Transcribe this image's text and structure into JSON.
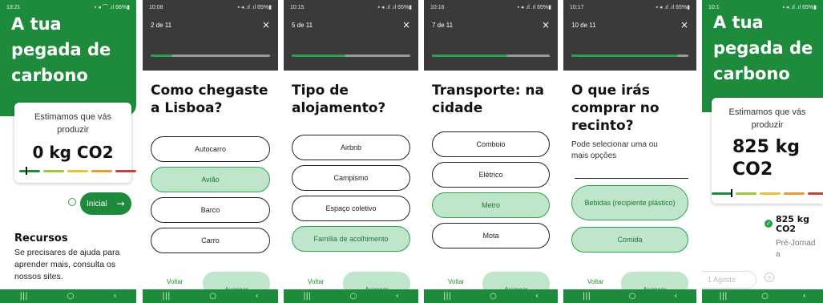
{
  "screens": [
    {
      "status_time": "13:21",
      "status_icons": "▪ ◂ ⌒ .ıl 66%▮",
      "title_lines": [
        "A tua",
        "pegada de",
        "carbono"
      ],
      "estimate_lines": [
        "Estimamos que vás",
        "produzir"
      ],
      "value": "0 kg CO2",
      "button_label": "Inicial",
      "resources_title": "Recursos",
      "resources_text": [
        "Se precisares de ajuda para",
        "aprender mais, consulta os",
        "nossos sites."
      ]
    },
    {
      "status_time": "10:08",
      "status_icons": "▪ ◂ .ıl .ıl 65%▮",
      "counter": "2 de 11",
      "progress": 0.18,
      "question_lines": [
        "Como chegaste",
        "a Lisboa?"
      ],
      "options": [
        {
          "label": "Autocarro",
          "selected": false
        },
        {
          "label": "Avião",
          "selected": true
        },
        {
          "label": "Barco",
          "selected": false
        },
        {
          "label": "Carro",
          "selected": false
        }
      ],
      "back": "Voltar",
      "next": "Avançar"
    },
    {
      "status_time": "10:15",
      "status_icons": "▪ ◂ .ıl .ıl 65%▮",
      "counter": "5 de 11",
      "progress": 0.45,
      "question_lines": [
        "Tipo de",
        "alojamento?"
      ],
      "options": [
        {
          "label": "Airbnb",
          "selected": false
        },
        {
          "label": "Campismo",
          "selected": false
        },
        {
          "label": "Espaço coletivo",
          "selected": false
        },
        {
          "label": "Família de acolhimento",
          "selected": true
        }
      ],
      "back": "Voltar",
      "next": "Avançar"
    },
    {
      "status_time": "10:16",
      "status_icons": "▪ ◂ .ıl .ıl 65%▮",
      "counter": "7 de 11",
      "progress": 0.64,
      "question_lines": [
        "Transporte: na",
        "cidade"
      ],
      "options": [
        {
          "label": "Comboio",
          "selected": false
        },
        {
          "label": "Elétrico",
          "selected": false
        },
        {
          "label": "Metro",
          "selected": true
        },
        {
          "label": "Mota",
          "selected": false
        }
      ],
      "back": "Voltar",
      "next": "Avançar"
    },
    {
      "status_time": "10:17",
      "status_icons": "▪ ◂ .ıl .ıl 65%▮",
      "counter": "10 de 11",
      "progress": 0.91,
      "question_lines": [
        "O que irás",
        "comprar no",
        "recinto?"
      ],
      "subtitle_lines": [
        "Pode selecionar uma ou",
        "mais opções"
      ],
      "options": [
        {
          "label": "Bebidas (recipiente plástico)",
          "selected": true
        },
        {
          "label": "Comida",
          "selected": true
        }
      ],
      "back": "Voltar",
      "next": "Avançar"
    },
    {
      "status_time": "10:1",
      "status_icons": "▪ ◂ .ıl .ıl 65%▮",
      "title_lines": [
        "A tua",
        "pegada de",
        "carbono"
      ],
      "estimate_lines": [
        "Estimamos que vás",
        "produzir"
      ],
      "value_lines": [
        "825 kg",
        "CO2"
      ],
      "timeline_value_lines": [
        "825 kg",
        "CO2"
      ],
      "timeline_label_lines": [
        "Pré-Jornad",
        "a"
      ],
      "date_chip": "1 Agosto"
    }
  ],
  "nav_icons": [
    "|||",
    "○",
    "‹"
  ],
  "colors": {
    "brand": "#1e8a3c",
    "selected": "#bfe5cb",
    "dark": "#3a3a3a"
  }
}
